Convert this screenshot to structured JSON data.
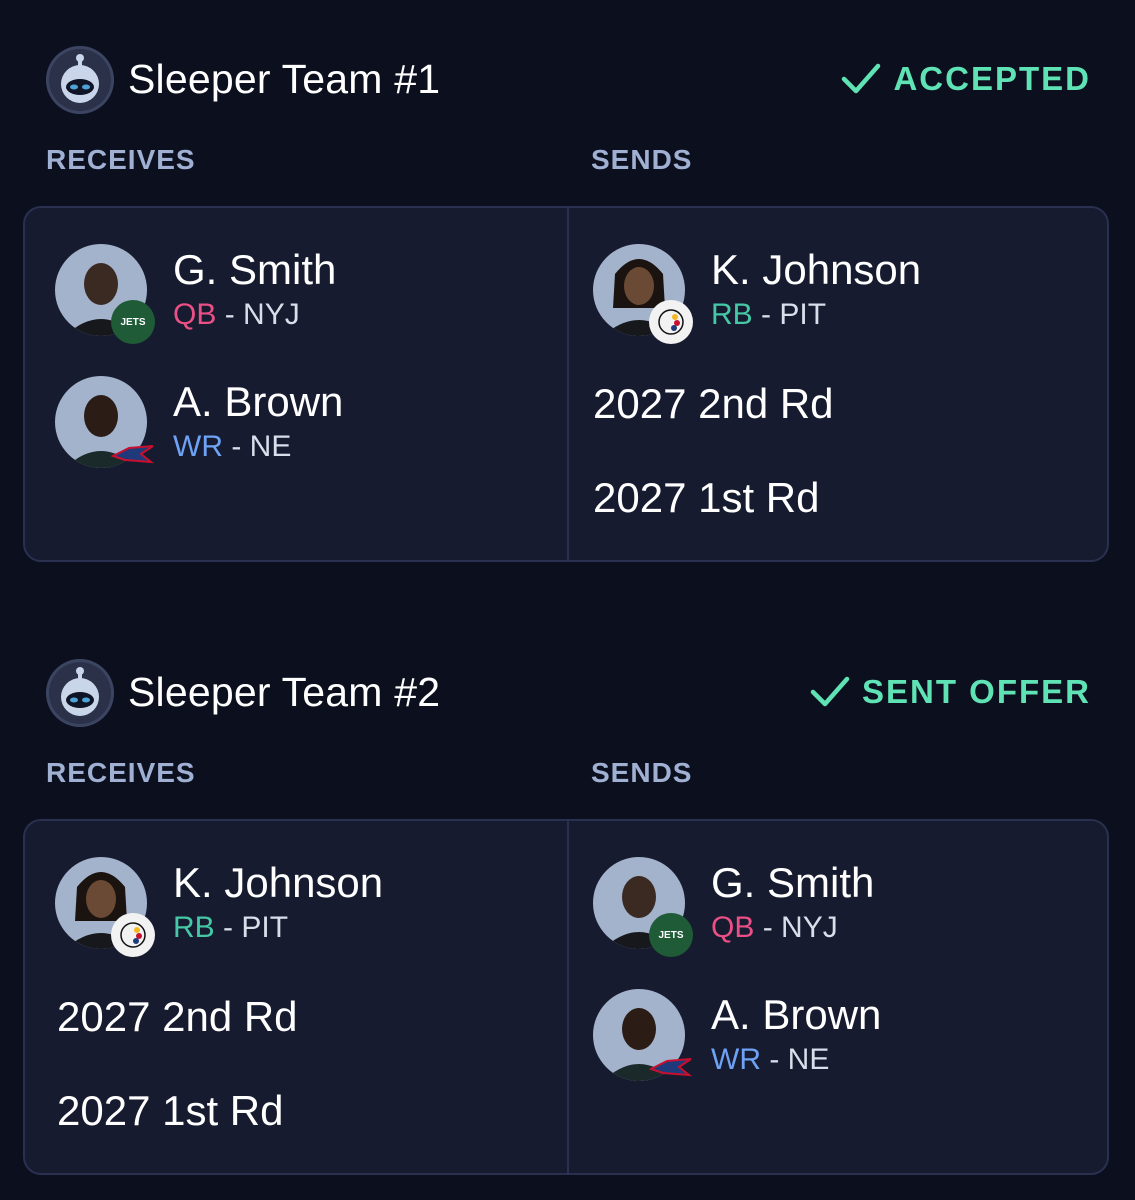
{
  "colors": {
    "background": "#0c0f1e",
    "card": "#171b2f",
    "accent": "#5fe3b4",
    "label": "#9fb0d3",
    "qb": "#ea4f86",
    "rb": "#45c8a6",
    "wr": "#6ea2f4"
  },
  "trades": [
    {
      "team_name": "Sleeper Team #1",
      "status": "ACCEPTED",
      "receives_label": "RECEIVES",
      "sends_label": "SENDS",
      "receives": {
        "players": [
          {
            "name": "G. Smith",
            "position": "QB",
            "sep": " - ",
            "team": "NYJ",
            "logo": "JETS"
          },
          {
            "name": "A. Brown",
            "position": "WR",
            "sep": " - ",
            "team": "NE",
            "logo": ""
          }
        ],
        "picks": []
      },
      "sends": {
        "players": [
          {
            "name": "K. Johnson",
            "position": "RB",
            "sep": " - ",
            "team": "PIT",
            "logo": "Steelers"
          }
        ],
        "picks": [
          "2027 2nd Rd",
          "2027 1st Rd"
        ]
      }
    },
    {
      "team_name": "Sleeper Team #2",
      "status": "SENT OFFER",
      "receives_label": "RECEIVES",
      "sends_label": "SENDS",
      "receives": {
        "players": [
          {
            "name": "K. Johnson",
            "position": "RB",
            "sep": " - ",
            "team": "PIT",
            "logo": "Steelers"
          }
        ],
        "picks": [
          "2027 2nd Rd",
          "2027 1st Rd"
        ]
      },
      "sends": {
        "players": [
          {
            "name": "G. Smith",
            "position": "QB",
            "sep": " - ",
            "team": "NYJ",
            "logo": "JETS"
          },
          {
            "name": "A. Brown",
            "position": "WR",
            "sep": " - ",
            "team": "NE",
            "logo": ""
          }
        ],
        "picks": []
      }
    }
  ]
}
